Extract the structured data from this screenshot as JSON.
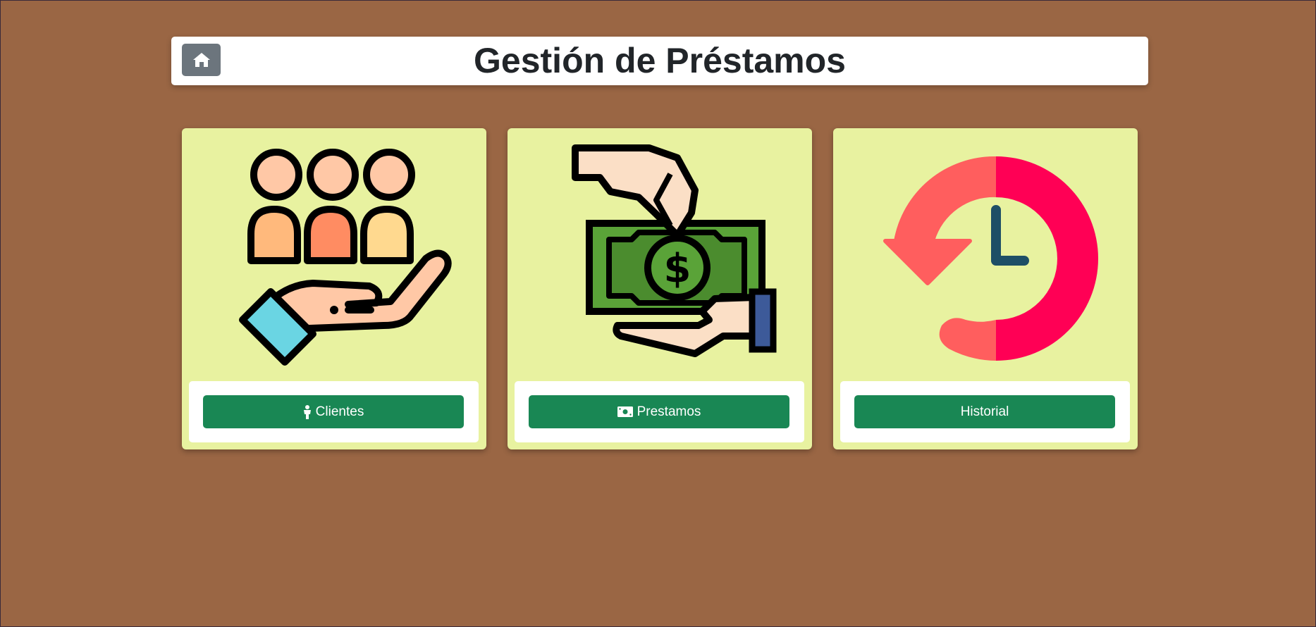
{
  "header": {
    "title": "Gestión de Préstamos",
    "home_icon": "house-icon"
  },
  "cards": [
    {
      "label": "Clientes",
      "icon": "person-icon",
      "image": "clients-hand-illustration"
    },
    {
      "label": "Prestamos",
      "icon": "money-bill-icon",
      "image": "money-exchange-illustration"
    },
    {
      "label": "Historial",
      "icon": "",
      "image": "history-clock-illustration"
    }
  ],
  "colors": {
    "background": "#9a6644",
    "card": "#e8f2a0",
    "button": "#198754",
    "home_button": "#6c757d"
  }
}
